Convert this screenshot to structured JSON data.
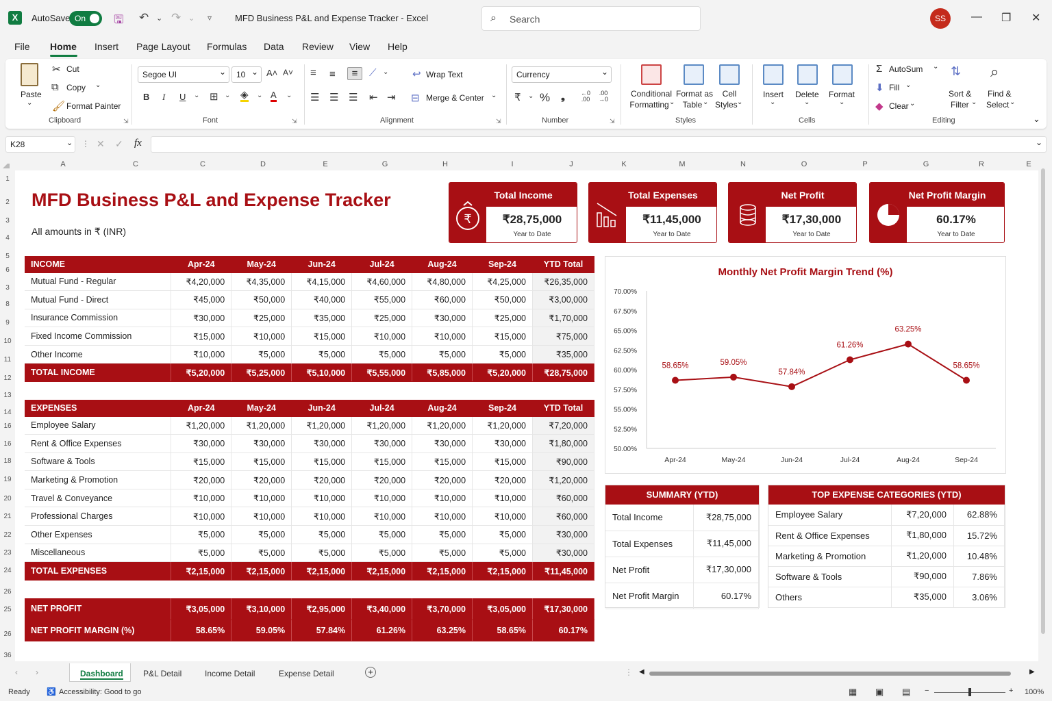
{
  "app": {
    "autosave_label": "AutoSave",
    "autosave_state": "On",
    "title": "MFD Business P&L and Expense Tracker  -  Excel",
    "search_placeholder": "Search",
    "user_initials": "SS"
  },
  "menu": [
    "File",
    "Home",
    "Insert",
    "Page Layout",
    "Formulas",
    "Data",
    "Review",
    "View",
    "Help"
  ],
  "ribbon": {
    "clipboard": {
      "paste": "Paste",
      "cut": "Cut",
      "copy": "Copy",
      "format_painter": "Format Painter",
      "group": "Clipboard"
    },
    "font": {
      "name": "Segoe UI",
      "size": "10",
      "group": "Font"
    },
    "alignment": {
      "wrap": "Wrap Text",
      "merge": "Merge & Center",
      "group": "Alignment"
    },
    "number": {
      "format": "Currency",
      "currency_symbol": "₹",
      "percent": "%",
      "comma": "❟",
      "group": "Number"
    },
    "styles": {
      "conditional": "Conditional",
      "formatting": "Formatting",
      "format_as": "Format as",
      "table": "Table",
      "cell": "Cell",
      "cell_styles": "Styles",
      "group": "Styles"
    },
    "cells": {
      "insert": "Insert",
      "delete": "Delete",
      "format": "Format",
      "group": "Cells"
    },
    "editing": {
      "autosum": "AutoSum",
      "fill": "Fill",
      "clear": "Clear",
      "sort": "Sort &",
      "filter": "Filter",
      "find": "Find &",
      "select": "Select",
      "group": "Editing"
    }
  },
  "formula_bar": {
    "name_box": "K28",
    "fx": "fx",
    "value": ""
  },
  "columns": [
    "A",
    "C",
    "C",
    "D",
    "E",
    "G",
    "H",
    "I",
    "J",
    "K",
    "M",
    "N",
    "O",
    "P",
    "G",
    "R",
    "E"
  ],
  "rows": [
    "1",
    "2",
    "3",
    "4",
    "5",
    "6",
    "3",
    "8",
    "9",
    "10",
    "11",
    "12",
    "13",
    "14",
    "16",
    "16",
    "18",
    "19",
    "20",
    "21",
    "22",
    "23",
    "24",
    "26",
    "25",
    "26",
    "36"
  ],
  "dashboard": {
    "title": "MFD Business P&L and Expense Tracker",
    "subtitle": "All amounts in ₹ (INR)",
    "kpis": [
      {
        "label": "Total Income",
        "value": "₹28,75,000",
        "sub": "Year to Date",
        "icon": "money-bag-icon"
      },
      {
        "label": "Total Expenses",
        "value": "₹11,45,000",
        "sub": "Year to Date",
        "icon": "bar-chart-down-icon"
      },
      {
        "label": "Net Profit",
        "value": "₹17,30,000",
        "sub": "Year to Date",
        "icon": "coins-icon"
      },
      {
        "label": "Net Profit Margin",
        "value": "60.17%",
        "sub": "Year to Date",
        "icon": "pie-chart-icon"
      }
    ],
    "income": {
      "header": [
        "INCOME",
        "Apr-24",
        "May-24",
        "Jun-24",
        "Jul-24",
        "Aug-24",
        "Sep-24",
        "YTD Total"
      ],
      "rows": [
        [
          "Mutual Fund - Regular",
          "₹4,20,000",
          "₹4,35,000",
          "₹4,15,000",
          "₹4,60,000",
          "₹4,80,000",
          "₹4,25,000",
          "₹26,35,000"
        ],
        [
          "Mutual Fund - Direct",
          "₹45,000",
          "₹50,000",
          "₹40,000",
          "₹55,000",
          "₹60,000",
          "₹50,000",
          "₹3,00,000"
        ],
        [
          "Insurance Commission",
          "₹30,000",
          "₹25,000",
          "₹35,000",
          "₹25,000",
          "₹30,000",
          "₹25,000",
          "₹1,70,000"
        ],
        [
          "Fixed Income Commission",
          "₹15,000",
          "₹10,000",
          "₹15,000",
          "₹10,000",
          "₹10,000",
          "₹15,000",
          "₹75,000"
        ],
        [
          "Other Income",
          "₹10,000",
          "₹5,000",
          "₹5,000",
          "₹5,000",
          "₹5,000",
          "₹5,000",
          "₹35,000"
        ]
      ],
      "total": [
        "TOTAL INCOME",
        "₹5,20,000",
        "₹5,25,000",
        "₹5,10,000",
        "₹5,55,000",
        "₹5,85,000",
        "₹5,20,000",
        "₹28,75,000"
      ]
    },
    "expenses": {
      "header": [
        "EXPENSES",
        "Apr-24",
        "May-24",
        "Jun-24",
        "Jul-24",
        "Aug-24",
        "Sep-24",
        "YTD Total"
      ],
      "rows": [
        [
          "Employee Salary",
          "₹1,20,000",
          "₹1,20,000",
          "₹1,20,000",
          "₹1,20,000",
          "₹1,20,000",
          "₹1,20,000",
          "₹7,20,000"
        ],
        [
          "Rent & Office Expenses",
          "₹30,000",
          "₹30,000",
          "₹30,000",
          "₹30,000",
          "₹30,000",
          "₹30,000",
          "₹1,80,000"
        ],
        [
          "Software & Tools",
          "₹15,000",
          "₹15,000",
          "₹15,000",
          "₹15,000",
          "₹15,000",
          "₹15,000",
          "₹90,000"
        ],
        [
          "Marketing & Promotion",
          "₹20,000",
          "₹20,000",
          "₹20,000",
          "₹20,000",
          "₹20,000",
          "₹20,000",
          "₹1,20,000"
        ],
        [
          "Travel & Conveyance",
          "₹10,000",
          "₹10,000",
          "₹10,000",
          "₹10,000",
          "₹10,000",
          "₹10,000",
          "₹60,000"
        ],
        [
          "Professional Charges",
          "₹10,000",
          "₹10,000",
          "₹10,000",
          "₹10,000",
          "₹10,000",
          "₹10,000",
          "₹60,000"
        ],
        [
          "Other Expenses",
          "₹5,000",
          "₹5,000",
          "₹5,000",
          "₹5,000",
          "₹5,000",
          "₹5,000",
          "₹30,000"
        ],
        [
          "Miscellaneous",
          "₹5,000",
          "₹5,000",
          "₹5,000",
          "₹5,000",
          "₹5,000",
          "₹5,000",
          "₹30,000"
        ]
      ],
      "total": [
        "TOTAL EXPENSES",
        "₹2,15,000",
        "₹2,15,000",
        "₹2,15,000",
        "₹2,15,000",
        "₹2,15,000",
        "₹2,15,000",
        "₹11,45,000"
      ]
    },
    "net": [
      [
        "NET PROFIT",
        "₹3,05,000",
        "₹3,10,000",
        "₹2,95,000",
        "₹3,40,000",
        "₹3,70,000",
        "₹3,05,000",
        "₹17,30,000"
      ],
      [
        "NET PROFIT MARGIN (%)",
        "58.65%",
        "59.05%",
        "57.84%",
        "61.26%",
        "63.25%",
        "58.65%",
        "60.17%"
      ]
    ],
    "summary": {
      "title": "SUMMARY (YTD)",
      "rows": [
        [
          "Total Income",
          "₹28,75,000"
        ],
        [
          "Total Expenses",
          "₹11,45,000"
        ],
        [
          "Net Profit",
          "₹17,30,000"
        ],
        [
          "Net Profit Margin",
          "60.17%"
        ]
      ]
    },
    "top_expenses": {
      "title": "TOP EXPENSE CATEGORIES (YTD)",
      "rows": [
        [
          "Employee Salary",
          "₹7,20,000",
          "62.88%"
        ],
        [
          "Rent & Office Expenses",
          "₹1,80,000",
          "15.72%"
        ],
        [
          "Marketing & Promotion",
          "₹1,20,000",
          "10.48%"
        ],
        [
          "Software & Tools",
          "₹90,000",
          "7.86%"
        ],
        [
          "Others",
          "₹35,000",
          "3.06%"
        ]
      ]
    }
  },
  "chart_data": {
    "type": "line",
    "title": "Monthly Net Profit Margin Trend (%)",
    "categories": [
      "Apr-24",
      "May-24",
      "Jun-24",
      "Jul-24",
      "Aug-24",
      "Sep-24"
    ],
    "values": [
      58.65,
      59.05,
      57.84,
      61.26,
      63.25,
      58.65
    ],
    "data_labels": [
      "58.65%",
      "59.05%",
      "57.84%",
      "61.26%",
      "63.25%",
      "58.65%"
    ],
    "yticks": [
      "70.00%",
      "67.50%",
      "65.00%",
      "62.50%",
      "60.00%",
      "57.50%",
      "55.00%",
      "52.50%",
      "50.00%"
    ],
    "ylim": [
      50,
      70
    ],
    "grid": false,
    "color": "#a80f14"
  },
  "sheet_tabs": [
    "Dashboard",
    "P&L Detail",
    "Income Detail",
    "Expense Detail"
  ],
  "status": {
    "ready": "Ready",
    "accessibility": "Accessibility: Good to go",
    "zoom": "100%"
  }
}
